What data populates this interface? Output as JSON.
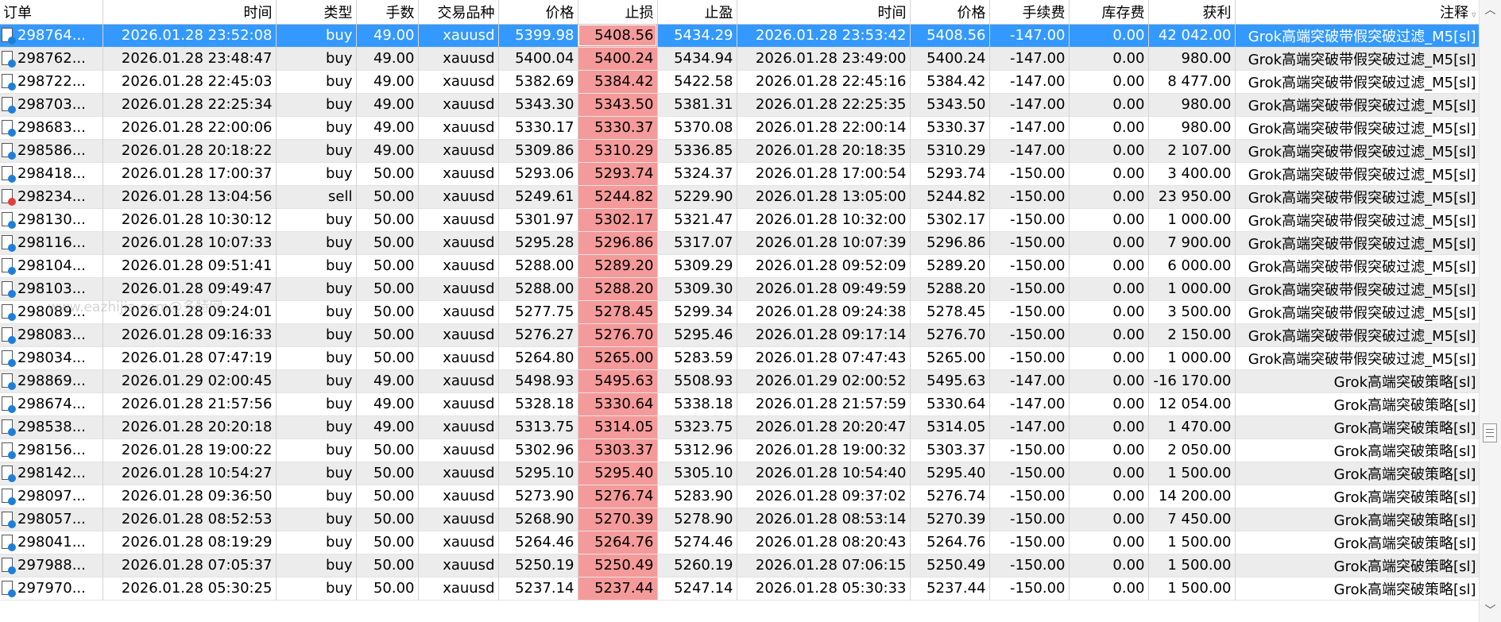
{
  "columns": {
    "order": "订单",
    "open_time": "时间",
    "type": "类型",
    "lots": "手数",
    "symbol": "交易品种",
    "open_price": "价格",
    "sl": "止损",
    "tp": "止盈",
    "close_time": "时间",
    "close_price": "价格",
    "commission": "手续费",
    "swap": "库存费",
    "profit": "获利",
    "comment": "注释"
  },
  "watermark": "www.eazhijia.com@多特网",
  "rows": [
    {
      "order": "298764...",
      "open_time": "2026.01.28 23:52:08",
      "type": "buy",
      "lots": "49.00",
      "symbol": "xauusd",
      "open_price": "5399.98",
      "sl": "5408.56",
      "tp": "5434.29",
      "close_time": "2026.01.28 23:53:42",
      "close_price": "5408.56",
      "commission": "-147.00",
      "swap": "0.00",
      "profit": "42 042.00",
      "comment": "Grok高端突破带假突破过滤_M5[sl]",
      "selected": true
    },
    {
      "order": "298762...",
      "open_time": "2026.01.28 23:48:47",
      "type": "buy",
      "lots": "49.00",
      "symbol": "xauusd",
      "open_price": "5400.04",
      "sl": "5400.24",
      "tp": "5434.94",
      "close_time": "2026.01.28 23:49:00",
      "close_price": "5400.24",
      "commission": "-147.00",
      "swap": "0.00",
      "profit": "980.00",
      "comment": "Grok高端突破带假突破过滤_M5[sl]"
    },
    {
      "order": "298722...",
      "open_time": "2026.01.28 22:45:03",
      "type": "buy",
      "lots": "49.00",
      "symbol": "xauusd",
      "open_price": "5382.69",
      "sl": "5384.42",
      "tp": "5422.58",
      "close_time": "2026.01.28 22:45:16",
      "close_price": "5384.42",
      "commission": "-147.00",
      "swap": "0.00",
      "profit": "8 477.00",
      "comment": "Grok高端突破带假突破过滤_M5[sl]"
    },
    {
      "order": "298703...",
      "open_time": "2026.01.28 22:25:34",
      "type": "buy",
      "lots": "49.00",
      "symbol": "xauusd",
      "open_price": "5343.30",
      "sl": "5343.50",
      "tp": "5381.31",
      "close_time": "2026.01.28 22:25:35",
      "close_price": "5343.50",
      "commission": "-147.00",
      "swap": "0.00",
      "profit": "980.00",
      "comment": "Grok高端突破带假突破过滤_M5[sl]"
    },
    {
      "order": "298683...",
      "open_time": "2026.01.28 22:00:06",
      "type": "buy",
      "lots": "49.00",
      "symbol": "xauusd",
      "open_price": "5330.17",
      "sl": "5330.37",
      "tp": "5370.08",
      "close_time": "2026.01.28 22:00:14",
      "close_price": "5330.37",
      "commission": "-147.00",
      "swap": "0.00",
      "profit": "980.00",
      "comment": "Grok高端突破带假突破过滤_M5[sl]"
    },
    {
      "order": "298586...",
      "open_time": "2026.01.28 20:18:22",
      "type": "buy",
      "lots": "49.00",
      "symbol": "xauusd",
      "open_price": "5309.86",
      "sl": "5310.29",
      "tp": "5336.85",
      "close_time": "2026.01.28 20:18:35",
      "close_price": "5310.29",
      "commission": "-147.00",
      "swap": "0.00",
      "profit": "2 107.00",
      "comment": "Grok高端突破带假突破过滤_M5[sl]"
    },
    {
      "order": "298418...",
      "open_time": "2026.01.28 17:00:37",
      "type": "buy",
      "lots": "50.00",
      "symbol": "xauusd",
      "open_price": "5293.06",
      "sl": "5293.74",
      "tp": "5324.37",
      "close_time": "2026.01.28 17:00:54",
      "close_price": "5293.74",
      "commission": "-150.00",
      "swap": "0.00",
      "profit": "3 400.00",
      "comment": "Grok高端突破带假突破过滤_M5[sl]"
    },
    {
      "order": "298234...",
      "open_time": "2026.01.28 13:04:56",
      "type": "sell",
      "lots": "50.00",
      "symbol": "xauusd",
      "open_price": "5249.61",
      "sl": "5244.82",
      "tp": "5229.90",
      "close_time": "2026.01.28 13:05:00",
      "close_price": "5244.82",
      "commission": "-150.00",
      "swap": "0.00",
      "profit": "23 950.00",
      "comment": "Grok高端突破带假突破过滤_M5[sl]"
    },
    {
      "order": "298130...",
      "open_time": "2026.01.28 10:30:12",
      "type": "buy",
      "lots": "50.00",
      "symbol": "xauusd",
      "open_price": "5301.97",
      "sl": "5302.17",
      "tp": "5321.47",
      "close_time": "2026.01.28 10:32:00",
      "close_price": "5302.17",
      "commission": "-150.00",
      "swap": "0.00",
      "profit": "1 000.00",
      "comment": "Grok高端突破带假突破过滤_M5[sl]"
    },
    {
      "order": "298116...",
      "open_time": "2026.01.28 10:07:33",
      "type": "buy",
      "lots": "50.00",
      "symbol": "xauusd",
      "open_price": "5295.28",
      "sl": "5296.86",
      "tp": "5317.07",
      "close_time": "2026.01.28 10:07:39",
      "close_price": "5296.86",
      "commission": "-150.00",
      "swap": "0.00",
      "profit": "7 900.00",
      "comment": "Grok高端突破带假突破过滤_M5[sl]"
    },
    {
      "order": "298104...",
      "open_time": "2026.01.28 09:51:41",
      "type": "buy",
      "lots": "50.00",
      "symbol": "xauusd",
      "open_price": "5288.00",
      "sl": "5289.20",
      "tp": "5309.29",
      "close_time": "2026.01.28 09:52:09",
      "close_price": "5289.20",
      "commission": "-150.00",
      "swap": "0.00",
      "profit": "6 000.00",
      "comment": "Grok高端突破带假突破过滤_M5[sl]"
    },
    {
      "order": "298103...",
      "open_time": "2026.01.28 09:49:47",
      "type": "buy",
      "lots": "50.00",
      "symbol": "xauusd",
      "open_price": "5288.00",
      "sl": "5288.20",
      "tp": "5309.30",
      "close_time": "2026.01.28 09:49:59",
      "close_price": "5288.20",
      "commission": "-150.00",
      "swap": "0.00",
      "profit": "1 000.00",
      "comment": "Grok高端突破带假突破过滤_M5[sl]"
    },
    {
      "order": "298089...",
      "open_time": "2026.01.28 09:24:01",
      "type": "buy",
      "lots": "50.00",
      "symbol": "xauusd",
      "open_price": "5277.75",
      "sl": "5278.45",
      "tp": "5299.34",
      "close_time": "2026.01.28 09:24:38",
      "close_price": "5278.45",
      "commission": "-150.00",
      "swap": "0.00",
      "profit": "3 500.00",
      "comment": "Grok高端突破带假突破过滤_M5[sl]"
    },
    {
      "order": "298083...",
      "open_time": "2026.01.28 09:16:33",
      "type": "buy",
      "lots": "50.00",
      "symbol": "xauusd",
      "open_price": "5276.27",
      "sl": "5276.70",
      "tp": "5295.46",
      "close_time": "2026.01.28 09:17:14",
      "close_price": "5276.70",
      "commission": "-150.00",
      "swap": "0.00",
      "profit": "2 150.00",
      "comment": "Grok高端突破带假突破过滤_M5[sl]"
    },
    {
      "order": "298034...",
      "open_time": "2026.01.28 07:47:19",
      "type": "buy",
      "lots": "50.00",
      "symbol": "xauusd",
      "open_price": "5264.80",
      "sl": "5265.00",
      "tp": "5283.59",
      "close_time": "2026.01.28 07:47:43",
      "close_price": "5265.00",
      "commission": "-150.00",
      "swap": "0.00",
      "profit": "1 000.00",
      "comment": "Grok高端突破带假突破过滤_M5[sl]"
    },
    {
      "order": "298869...",
      "open_time": "2026.01.29 02:00:45",
      "type": "buy",
      "lots": "49.00",
      "symbol": "xauusd",
      "open_price": "5498.93",
      "sl": "5495.63",
      "tp": "5508.93",
      "close_time": "2026.01.29 02:00:52",
      "close_price": "5495.63",
      "commission": "-147.00",
      "swap": "0.00",
      "profit": "-16 170.00",
      "comment": "Grok高端突破策略[sl]"
    },
    {
      "order": "298674...",
      "open_time": "2026.01.28 21:57:56",
      "type": "buy",
      "lots": "49.00",
      "symbol": "xauusd",
      "open_price": "5328.18",
      "sl": "5330.64",
      "tp": "5338.18",
      "close_time": "2026.01.28 21:57:59",
      "close_price": "5330.64",
      "commission": "-147.00",
      "swap": "0.00",
      "profit": "12 054.00",
      "comment": "Grok高端突破策略[sl]"
    },
    {
      "order": "298538...",
      "open_time": "2026.01.28 20:20:18",
      "type": "buy",
      "lots": "49.00",
      "symbol": "xauusd",
      "open_price": "5313.75",
      "sl": "5314.05",
      "tp": "5323.75",
      "close_time": "2026.01.28 20:20:47",
      "close_price": "5314.05",
      "commission": "-147.00",
      "swap": "0.00",
      "profit": "1 470.00",
      "comment": "Grok高端突破策略[sl]"
    },
    {
      "order": "298156...",
      "open_time": "2026.01.28 19:00:22",
      "type": "buy",
      "lots": "50.00",
      "symbol": "xauusd",
      "open_price": "5302.96",
      "sl": "5303.37",
      "tp": "5312.96",
      "close_time": "2026.01.28 19:00:32",
      "close_price": "5303.37",
      "commission": "-150.00",
      "swap": "0.00",
      "profit": "2 050.00",
      "comment": "Grok高端突破策略[sl]"
    },
    {
      "order": "298142...",
      "open_time": "2026.01.28 10:54:27",
      "type": "buy",
      "lots": "50.00",
      "symbol": "xauusd",
      "open_price": "5295.10",
      "sl": "5295.40",
      "tp": "5305.10",
      "close_time": "2026.01.28 10:54:40",
      "close_price": "5295.40",
      "commission": "-150.00",
      "swap": "0.00",
      "profit": "1 500.00",
      "comment": "Grok高端突破策略[sl]"
    },
    {
      "order": "298097...",
      "open_time": "2026.01.28 09:36:50",
      "type": "buy",
      "lots": "50.00",
      "symbol": "xauusd",
      "open_price": "5273.90",
      "sl": "5276.74",
      "tp": "5283.90",
      "close_time": "2026.01.28 09:37:02",
      "close_price": "5276.74",
      "commission": "-150.00",
      "swap": "0.00",
      "profit": "14 200.00",
      "comment": "Grok高端突破策略[sl]"
    },
    {
      "order": "298057...",
      "open_time": "2026.01.28 08:52:53",
      "type": "buy",
      "lots": "50.00",
      "symbol": "xauusd",
      "open_price": "5268.90",
      "sl": "5270.39",
      "tp": "5278.90",
      "close_time": "2026.01.28 08:53:14",
      "close_price": "5270.39",
      "commission": "-150.00",
      "swap": "0.00",
      "profit": "7 450.00",
      "comment": "Grok高端突破策略[sl]"
    },
    {
      "order": "298041...",
      "open_time": "2026.01.28 08:19:29",
      "type": "buy",
      "lots": "50.00",
      "symbol": "xauusd",
      "open_price": "5264.46",
      "sl": "5264.76",
      "tp": "5274.46",
      "close_time": "2026.01.28 08:20:43",
      "close_price": "5264.76",
      "commission": "-150.00",
      "swap": "0.00",
      "profit": "1 500.00",
      "comment": "Grok高端突破策略[sl]"
    },
    {
      "order": "297988...",
      "open_time": "2026.01.28 07:05:37",
      "type": "buy",
      "lots": "50.00",
      "symbol": "xauusd",
      "open_price": "5250.19",
      "sl": "5250.49",
      "tp": "5260.19",
      "close_time": "2026.01.28 07:06:15",
      "close_price": "5250.49",
      "commission": "-150.00",
      "swap": "0.00",
      "profit": "1 500.00",
      "comment": "Grok高端突破策略[sl]"
    },
    {
      "order": "297970...",
      "open_time": "2026.01.28 05:30:25",
      "type": "buy",
      "lots": "50.00",
      "symbol": "xauusd",
      "open_price": "5237.14",
      "sl": "5237.44",
      "tp": "5247.14",
      "close_time": "2026.01.28 05:30:33",
      "close_price": "5237.44",
      "commission": "-150.00",
      "swap": "0.00",
      "profit": "1 500.00",
      "comment": "Grok高端突破策略[sl]"
    }
  ]
}
